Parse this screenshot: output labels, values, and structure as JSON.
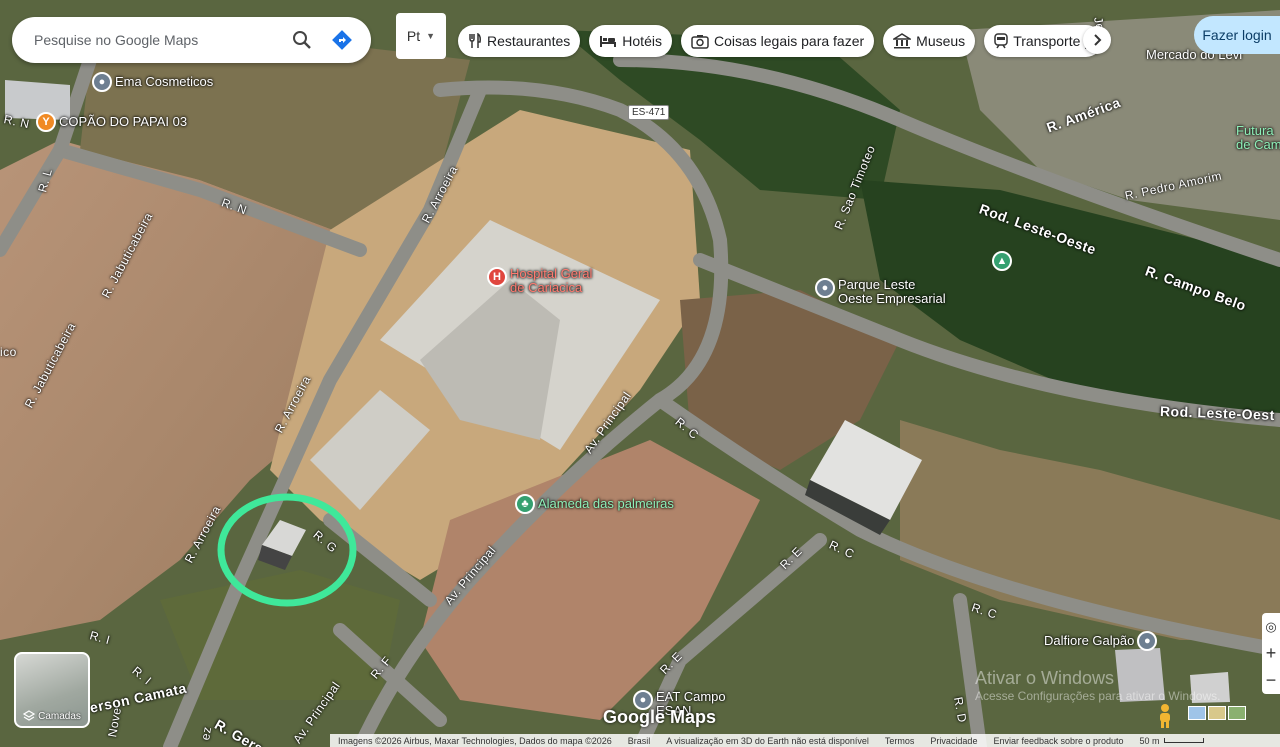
{
  "search": {
    "placeholder": "Pesquise no Google Maps"
  },
  "language": {
    "label": "Pt"
  },
  "chips": [
    {
      "label": "Restaurantes",
      "icon": "fork-knife-icon"
    },
    {
      "label": "Hotéis",
      "icon": "bed-icon"
    },
    {
      "label": "Coisas legais para fazer",
      "icon": "camera-icon"
    },
    {
      "label": "Museus",
      "icon": "museum-icon"
    },
    {
      "label": "Transporte p",
      "icon": "train-icon"
    }
  ],
  "login": {
    "label": "Fazer login"
  },
  "layers": {
    "label": "Camadas"
  },
  "controls": {
    "zoom_in": "+",
    "zoom_out": "−"
  },
  "colors": {
    "highlight_circle": "#3fe89a",
    "accent_blue": "#c2e7ff",
    "hospital_red": "#e0463e"
  },
  "roads": [
    {
      "label": "R. N"
    },
    {
      "label": "R. L"
    },
    {
      "label": "R. N"
    },
    {
      "label": "R. Jabuticabeira"
    },
    {
      "label": "R. Jabuticabeira"
    },
    {
      "label": "R. Arroeira"
    },
    {
      "label": "R. Arroeira"
    },
    {
      "label": "R. Arroeira"
    },
    {
      "label": "R. G"
    },
    {
      "label": "Av. Principal"
    },
    {
      "label": "Av. Principal"
    },
    {
      "label": "Av. Principal"
    },
    {
      "label": "R. C"
    },
    {
      "label": "R. C"
    },
    {
      "label": "R. C"
    },
    {
      "label": "R. E"
    },
    {
      "label": "R. E"
    },
    {
      "label": "R. F"
    },
    {
      "label": "R. I"
    },
    {
      "label": "R. I"
    },
    {
      "label": "R. Sao Timoteo"
    },
    {
      "label": "Rod. Leste-Oeste"
    },
    {
      "label": "Rod. Leste-Oest"
    },
    {
      "label": "R. Campo Belo"
    },
    {
      "label": "R. América"
    },
    {
      "label": "R. Pedro Amorim"
    },
    {
      "label": "Jesus"
    },
    {
      "label": "R. D"
    },
    {
      "label": "erson Camata"
    },
    {
      "label": "R. Gers"
    },
    {
      "label": "Nove"
    },
    {
      "label": "ez"
    },
    {
      "label": "ico"
    }
  ],
  "shield": {
    "label": "ES-471"
  },
  "pois": [
    {
      "label": "Ema Cosmeticos",
      "icon": "map-pin-icon"
    },
    {
      "label": "COPÃO DO PAPAI 03",
      "icon": "cocktail-icon"
    },
    {
      "label": "Hospital Geral\nde Cariacica",
      "icon": "hospital-icon",
      "pin": "H"
    },
    {
      "label": "Parque Leste\nOeste Empresarial",
      "icon": "map-pin-icon"
    },
    {
      "label": "Alameda das palmeiras",
      "icon": "park-icon"
    },
    {
      "label": "Dalfiore Galpão",
      "icon": "map-pin-icon"
    },
    {
      "label": "EAT Campo\nESAN",
      "icon": "map-pin-icon"
    },
    {
      "label": "Mercado do Levi",
      "icon": "map-pin-icon"
    },
    {
      "label": "Futura\nde Campo",
      "icon": "map-pin-icon"
    }
  ],
  "watermark": {
    "line1": "Ativar o Windows",
    "line2": "Acesse Configurações para ativar o Windows."
  },
  "logo": "Google Maps",
  "footer": {
    "attribution": "Imagens ©2026 Airbus, Maxar Technologies, Dados do mapa ©2026",
    "country": "Brasil",
    "notice": "A visualização em 3D do Earth não está disponível",
    "terms": "Termos",
    "privacy": "Privacidade",
    "feedback": "Enviar feedback sobre o produto",
    "scale": "50 m"
  }
}
